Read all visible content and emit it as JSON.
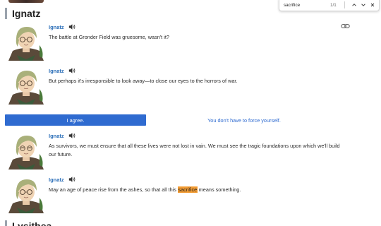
{
  "sections": [
    {
      "title": "Ignatz"
    },
    {
      "title": "Lysithea"
    }
  ],
  "messages": [
    {
      "speaker": "Ignatz",
      "text": "The battle at Gronder Field was gruesome, wasn't it?"
    },
    {
      "speaker": "Ignatz",
      "text": "But perhaps it's irresponsible to look away—to close our eyes to the horrors of war."
    },
    {
      "speaker": "Ignatz",
      "text": "As survivors, we must ensure that all these lives were not lost in vain. We must see the tragic foundations upon which we'll build our future."
    },
    {
      "speaker": "Ignatz",
      "text_before": "May an age of peace rise from the ashes, so that all this ",
      "text_highlight": "sacrifice",
      "text_after": " means something."
    }
  ],
  "choices": {
    "primary": "I agree.",
    "secondary": "You don't have to force yourself."
  },
  "findbar": {
    "query": "sacrifice",
    "count": "1/1"
  },
  "icons": {
    "sound": "speaker-icon",
    "link": "link-icon",
    "up": "chevron-up-icon",
    "down": "chevron-down-icon",
    "close": "close-icon"
  },
  "colors": {
    "accent": "#2f6bd0",
    "speaker": "#2c6fb8",
    "highlight": "#f39c33"
  }
}
